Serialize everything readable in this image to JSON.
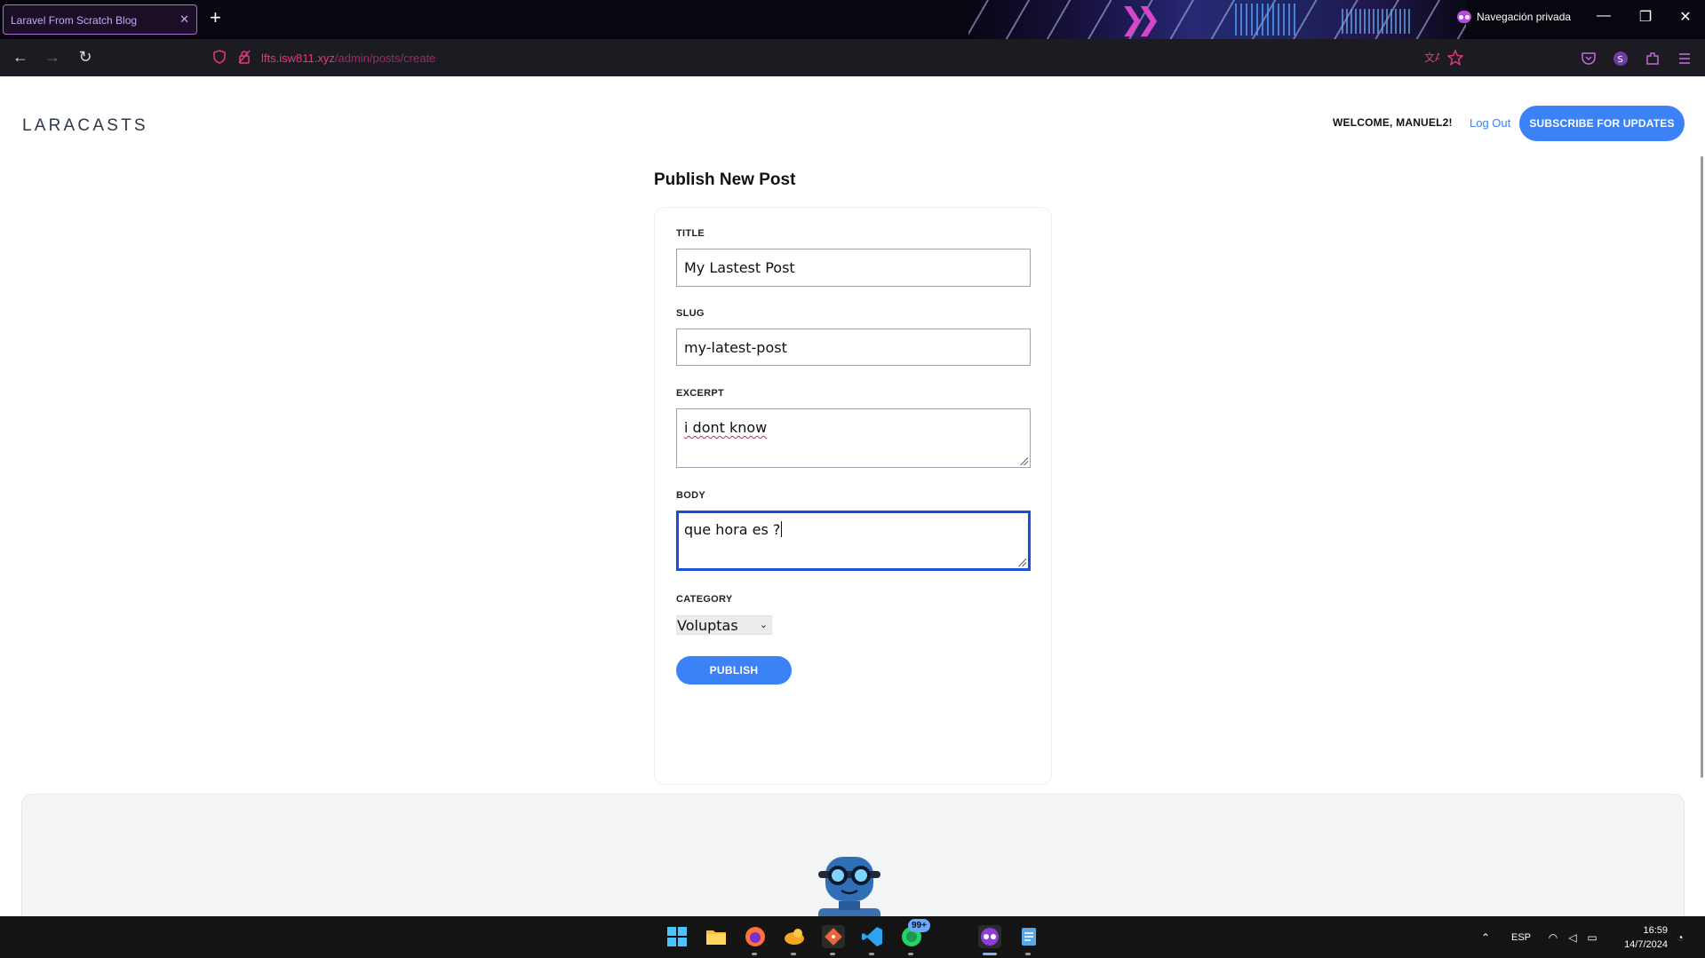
{
  "browser": {
    "tab_title": "Laravel From Scratch Blog",
    "tab_close": "✕",
    "new_tab": "+",
    "private_label": "Navegación privada",
    "url_host": "lfts.isw811.xyz",
    "url_path": "/admin/posts/create",
    "nav": {
      "back": "←",
      "forward": "→",
      "reload": "↻"
    },
    "window": {
      "minimize": "—",
      "restore": "❐",
      "close": "✕"
    }
  },
  "header": {
    "logo_text": "LARACASTS",
    "welcome": "WELCOME, MANUEL2!",
    "logout": "Log Out",
    "subscribe": "SUBSCRIBE FOR UPDATES"
  },
  "form": {
    "heading": "Publish New Post",
    "title_label": "TITLE",
    "title_value": "My Lastest Post",
    "slug_label": "SLUG",
    "slug_value": "my-latest-post",
    "excerpt_label": "EXCERPT",
    "excerpt_value": "i dont know",
    "body_label": "BODY",
    "body_value": "que hora es ?",
    "category_label": "CATEGORY",
    "category_selected": "Voluptas",
    "publish": "PUBLISH"
  },
  "taskbar": {
    "whatsapp_badge": "99+",
    "language": "ESP",
    "time": "16:59",
    "date": "14/7/2024"
  },
  "colors": {
    "accent": "#3b82f6",
    "focus_border": "#1d4ed8",
    "url_host": "#e5397e",
    "private": "#b34be0"
  }
}
